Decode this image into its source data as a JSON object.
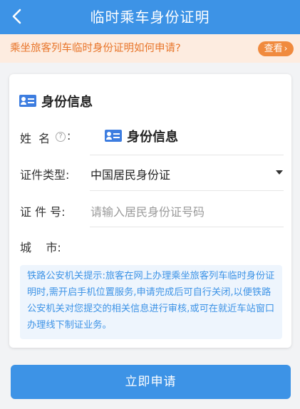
{
  "header": {
    "title": "临时乘车身份证明"
  },
  "notice": {
    "text": "乘坐旅客列车临时身份证明如何申请?",
    "button_label": "查看",
    "button_chevron": "›"
  },
  "form": {
    "section_title": "身份信息",
    "name_label": "姓  名",
    "name_colon": ":",
    "name_value_title": "身份信息",
    "id_type_label": "证件类型:",
    "id_type_value": "中国居民身份证",
    "id_number_label": "证 件 号:",
    "id_number_placeholder": "请输入居民身份证号码",
    "city_label": "城    市:",
    "help_glyph": "?"
  },
  "tip": {
    "text": "铁路公安机关提示:旅客在网上办理乘坐旅客列车临时身份证明时,需开启手机位置服务,申请完成后可自行关闭,以便铁路公安机关对您提交的相关信息进行审核,或可在就近车站窗口办理线下制证业务。"
  },
  "submit": {
    "label": "立即申请"
  },
  "colors": {
    "primary": "#3d93e6",
    "notice_bg": "#fdece0",
    "notice_text": "#e8752a",
    "notice_button": "#f08a3e"
  }
}
